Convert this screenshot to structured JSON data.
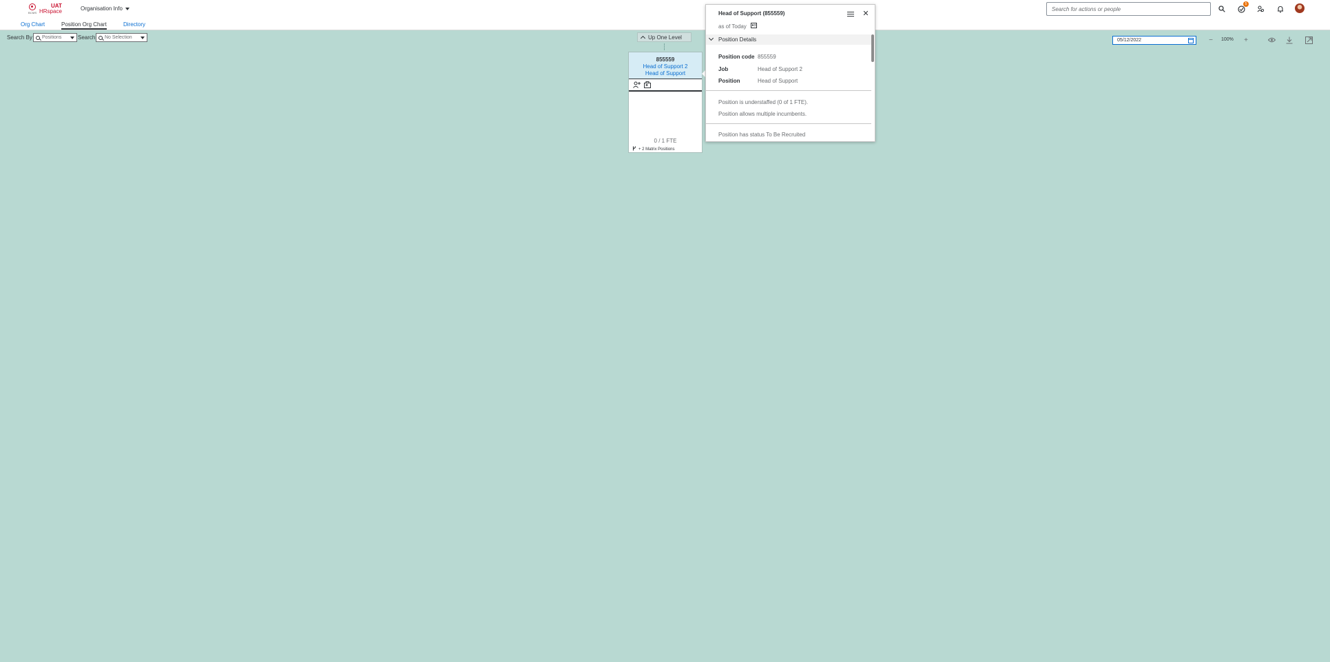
{
  "shell": {
    "logo_small": "BCMS",
    "logo_uat": "UAT",
    "logo_hr": "HRspace",
    "app_menu": "Organisation Info",
    "search_placeholder": "Search for actions or people",
    "notification_count": "5"
  },
  "tabs": [
    {
      "label": "Org Chart",
      "active": false
    },
    {
      "label": "Position Org Chart",
      "active": true
    },
    {
      "label": "Directory",
      "active": false
    }
  ],
  "toolbar": {
    "search_by_label": "Search By",
    "search_by_value": "Positions",
    "search_label": "Search",
    "search_value": "No Selection",
    "up_one_level": "Up One Level",
    "date": "05/12/2022",
    "zoom": "100%"
  },
  "card": {
    "code": "855559",
    "job": "Head of Support 2",
    "position": "Head of Support",
    "fte": "0 / 1 FTE",
    "matrix": "+ 2 Matrix Positions"
  },
  "popover": {
    "title": "Head of Support (855559)",
    "as_of": "as of Today",
    "section": "Position Details",
    "rows": [
      {
        "label": "Position code",
        "value": "855559"
      },
      {
        "label": "Job",
        "value": "Head of Support 2"
      },
      {
        "label": "Position",
        "value": "Head of Support"
      }
    ],
    "notes": [
      "Position is understaffed (0 of 1 FTE).",
      "Position allows multiple incumbents."
    ],
    "status": "Position has status To Be Recruited"
  },
  "colors": {
    "canvas": "#b8d9d2",
    "accent": "#0a6ed1",
    "brand": "#c8102e",
    "card_header": "#d6ecf5"
  }
}
